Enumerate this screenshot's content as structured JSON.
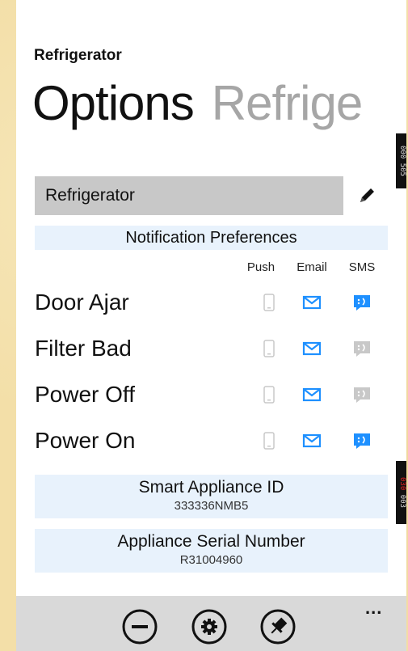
{
  "app": {
    "title": "Refrigerator"
  },
  "pivot": {
    "active": "Options",
    "next": "Refrige"
  },
  "side_indicators": {
    "top_line1": "000",
    "top_line2": "505",
    "bottom_line1": "030",
    "bottom_line2": "003"
  },
  "device_name": {
    "value": "Refrigerator"
  },
  "notifications": {
    "header": "Notification Preferences",
    "columns": {
      "push": "Push",
      "email": "Email",
      "sms": "SMS"
    },
    "rows": [
      {
        "label": "Door Ajar",
        "push": false,
        "email": true,
        "sms": true
      },
      {
        "label": "Filter Bad",
        "push": false,
        "email": true,
        "sms": false
      },
      {
        "label": "Power Off",
        "push": false,
        "email": true,
        "sms": false
      },
      {
        "label": "Power On",
        "push": false,
        "email": true,
        "sms": true
      }
    ]
  },
  "smart_id": {
    "title": "Smart Appliance ID",
    "value": "333336NMB5"
  },
  "serial": {
    "title": "Appliance Serial Number",
    "value": "R31004960"
  },
  "appbar": {
    "more": "...",
    "buttons": [
      "remove-icon",
      "settings-icon",
      "pin-icon"
    ]
  },
  "colors": {
    "accent": "#1e90ff",
    "inactive_icon": "#c8c8c8",
    "section_bg": "#e8f2fc",
    "field_bg": "#c8c8c8"
  }
}
